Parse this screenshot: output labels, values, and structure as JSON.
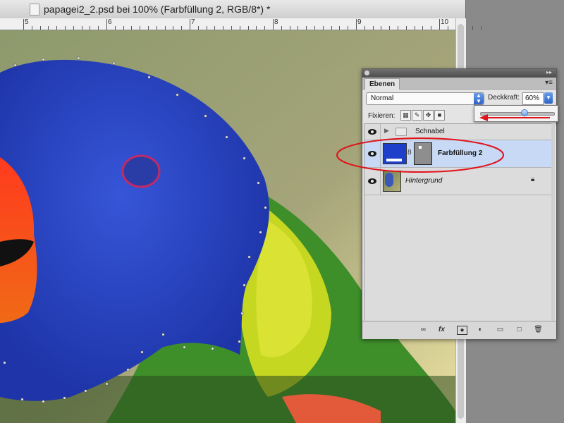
{
  "document": {
    "title": "papagei2_2.psd bei 100% (Farbfüllung 2, RGB/8*) *",
    "ruler_numbers": [
      "5",
      "6",
      "7",
      "8",
      "9",
      "10"
    ]
  },
  "layers_panel": {
    "tab_label": "Ebenen",
    "blend_mode": "Normal",
    "opacity_label": "Deckkraft:",
    "opacity_value": "60%",
    "opacity_fraction": 0.6,
    "lock_label": "Fixieren:",
    "layers": [
      {
        "name": "Schnabel",
        "type": "group"
      },
      {
        "name": "Farbfüllung 2",
        "type": "fill",
        "selected": true,
        "fill_color": "#1d3fc9"
      },
      {
        "name": "Hintergrund",
        "type": "background",
        "locked": true
      }
    ],
    "bottom_icons": [
      "link-layers-icon",
      "fx-icon",
      "add-mask-icon",
      "adjustment-layer-icon",
      "new-group-icon",
      "new-layer-icon",
      "trash-icon"
    ]
  },
  "colors": {
    "annotation_red": "#e0141c",
    "selection_blue": "#c7d9f5",
    "fill_blue": "#1d3fc9"
  }
}
